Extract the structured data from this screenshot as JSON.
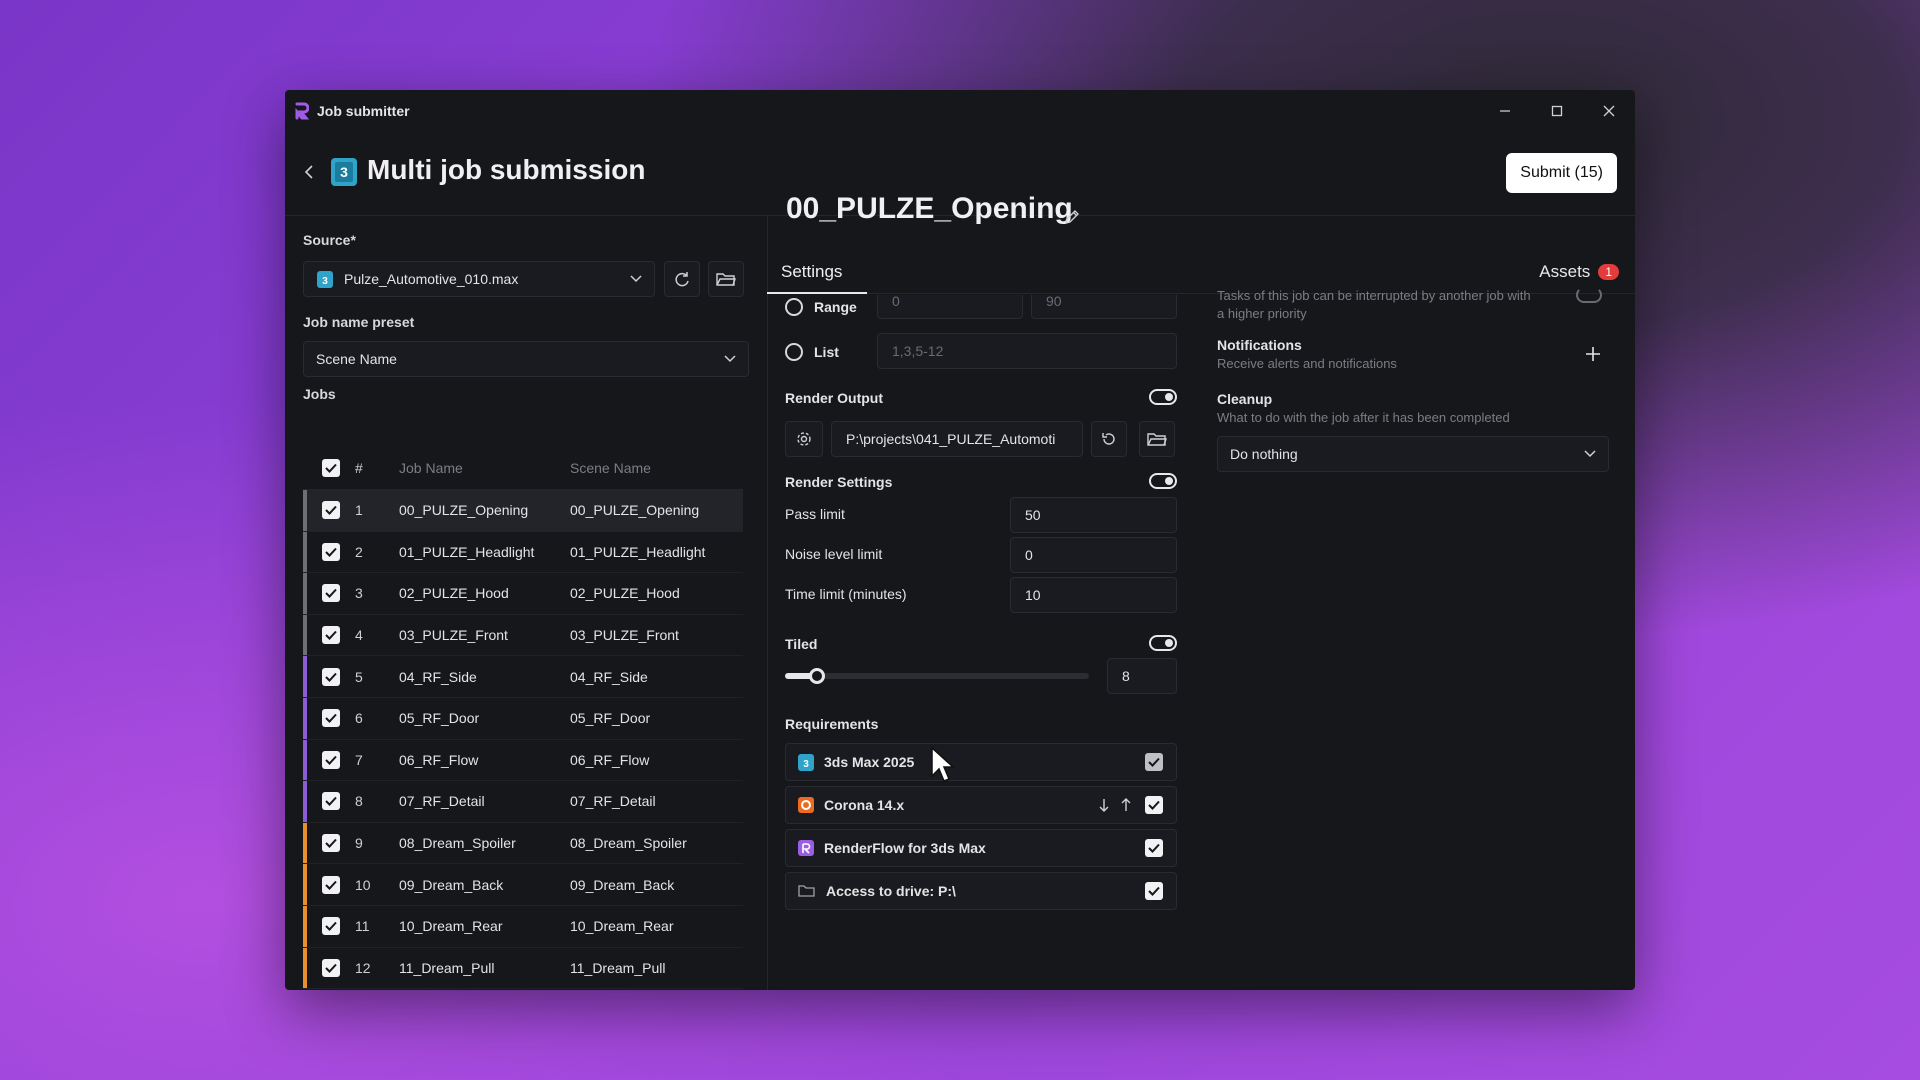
{
  "app": {
    "title": "Job submitter"
  },
  "header": {
    "title": "Multi job submission",
    "submit_label": "Submit (15)"
  },
  "left": {
    "source_label": "Source*",
    "source_value": "Pulze_Automotive_010.max",
    "preset_label": "Job name preset",
    "preset_value": "Scene Name",
    "jobs_label": "Jobs",
    "columns": {
      "num": "#",
      "job": "Job Name",
      "scene": "Scene Name"
    },
    "jobs": [
      {
        "num": "1",
        "job": "00_PULZE_Opening",
        "scene": "00_PULZE_Opening",
        "color": "#6e6f75"
      },
      {
        "num": "2",
        "job": "01_PULZE_Headlight",
        "scene": "01_PULZE_Headlight",
        "color": "#6e6f75"
      },
      {
        "num": "3",
        "job": "02_PULZE_Hood",
        "scene": "02_PULZE_Hood",
        "color": "#6e6f75"
      },
      {
        "num": "4",
        "job": "03_PULZE_Front",
        "scene": "03_PULZE_Front",
        "color": "#6e6f75"
      },
      {
        "num": "5",
        "job": "04_RF_Side",
        "scene": "04_RF_Side",
        "color": "#8a5cd6"
      },
      {
        "num": "6",
        "job": "05_RF_Door",
        "scene": "05_RF_Door",
        "color": "#8a5cd6"
      },
      {
        "num": "7",
        "job": "06_RF_Flow",
        "scene": "06_RF_Flow",
        "color": "#8a5cd6"
      },
      {
        "num": "8",
        "job": "07_RF_Detail",
        "scene": "07_RF_Detail",
        "color": "#8a5cd6"
      },
      {
        "num": "9",
        "job": "08_Dream_Spoiler",
        "scene": "08_Dream_Spoiler",
        "color": "#e8902e"
      },
      {
        "num": "10",
        "job": "09_Dream_Back",
        "scene": "09_Dream_Back",
        "color": "#e8902e"
      },
      {
        "num": "11",
        "job": "10_Dream_Rear",
        "scene": "10_Dream_Rear",
        "color": "#e8902e"
      },
      {
        "num": "12",
        "job": "11_Dream_Pull",
        "scene": "11_Dream_Pull",
        "color": "#e8902e"
      }
    ]
  },
  "job": {
    "title": "00_PULZE_Opening",
    "tab_settings": "Settings",
    "tab_assets": "Assets",
    "assets_count": "1"
  },
  "settings": {
    "range_label": "Range",
    "range_from_placeholder": "0",
    "range_to_placeholder": "90",
    "list_label": "List",
    "list_placeholder": "1,3,5-12",
    "render_output_label": "Render Output",
    "render_output_path": "P:\\projects\\041_PULZE_Automoti",
    "render_settings_label": "Render Settings",
    "pass_limit_label": "Pass limit",
    "pass_limit_value": "50",
    "noise_label": "Noise level limit",
    "noise_value": "0",
    "time_label": "Time limit (minutes)",
    "time_value": "10",
    "tiled_label": "Tiled",
    "tiled_value": "8",
    "tiled_fraction": 0.08,
    "requirements_label": "Requirements",
    "requirements": [
      {
        "name": "3ds Max 2025",
        "checked": "grey"
      },
      {
        "name": "Corona 14.x",
        "checked": "white"
      },
      {
        "name": "RenderFlow for 3ds Max",
        "checked": "white"
      },
      {
        "name": "Access to drive: P:\\",
        "checked": "white"
      }
    ]
  },
  "right": {
    "interrupt_desc": "Tasks of this job can be interrupted by another job with a higher priority",
    "notifications_title": "Notifications",
    "notifications_desc": "Receive alerts and notifications",
    "cleanup_title": "Cleanup",
    "cleanup_desc": "What to do with the job after it has been completed",
    "cleanup_value": "Do nothing"
  },
  "colors": {
    "accent": "#e23c3c",
    "brand": "#8a5cd6"
  }
}
